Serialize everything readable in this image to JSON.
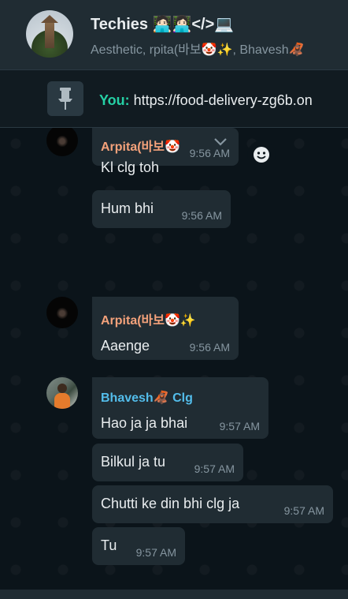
{
  "header": {
    "title": "Techies 🧑🏻‍💻👩🏻‍💻</>💻",
    "subtitle": "Aesthetic, rpita(바보🤡✨, Bhavesh🦧"
  },
  "pinned": {
    "sender": "You:",
    "text": " https://food-delivery-zg6b.on"
  },
  "messages": [
    {
      "sender": "Arpita(바보🤡",
      "text": "Kl clg toh",
      "time": "9:56 AM"
    },
    {
      "text": "Hum bhi",
      "time": "9:56 AM"
    },
    {
      "sender": "Arpita(바보🤡✨",
      "text": "Aaenge",
      "time": "9:56 AM"
    },
    {
      "sender": "Bhavesh🦧 Clg",
      "text": "Hao ja ja bhai",
      "time": "9:57 AM"
    },
    {
      "text": "Bilkul ja tu",
      "time": "9:57 AM"
    },
    {
      "text": "Chutti ke din bhi clg ja",
      "time": "9:57 AM"
    },
    {
      "text": "Tu",
      "time": "9:57 AM"
    }
  ],
  "colors": {
    "arpita": "#f4a27b",
    "bhavesh": "#53bdeb",
    "you": "#25d0a5",
    "bubble": "#202c33",
    "background": "#0b141a"
  },
  "icons": [
    "pin-icon",
    "chevron-down-icon",
    "emoji-icon"
  ]
}
